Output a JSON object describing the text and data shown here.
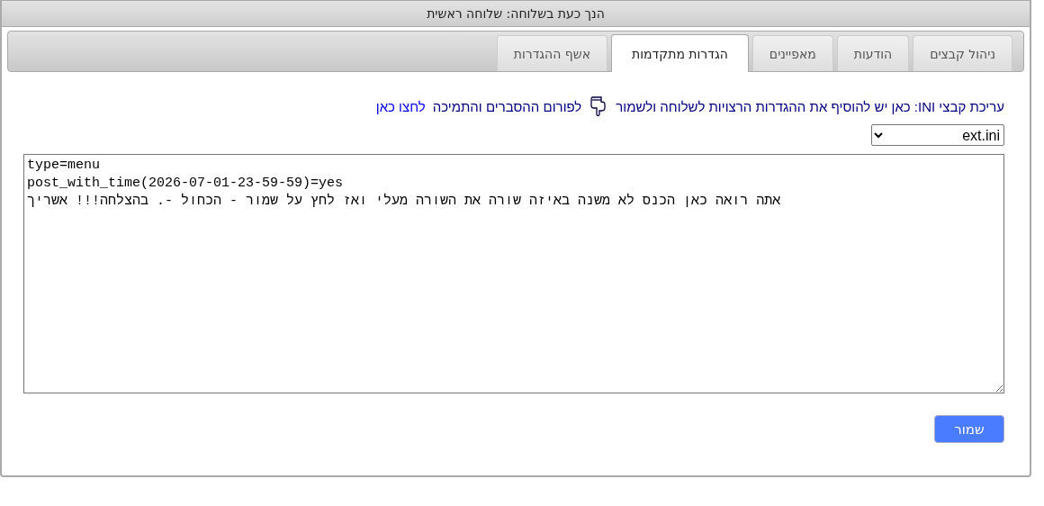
{
  "window": {
    "title": "הנך כעת בשלוחה: שלוחה ראשית"
  },
  "tabs": [
    {
      "label": "ניהול קבצים",
      "selected": false
    },
    {
      "label": "הודעות",
      "selected": false
    },
    {
      "label": "מאפיינים",
      "selected": false
    },
    {
      "label": "הגדרות מתקדמות",
      "selected": true
    },
    {
      "label": "אשף ההגדרות",
      "selected": false
    }
  ],
  "notice": {
    "text": "עריכת קבצי INI: כאן יש להוסיף את ההגדרות הרצויות לשלוחה ולשמור",
    "forum_text": "לפורום ההסברים והתמיכה",
    "link": "לחצו כאן"
  },
  "file_select": {
    "value": "ext.ini"
  },
  "editor": {
    "lines": [
      "type=menu",
      "post_with_time(2026-07-01-23-59-59)=yes",
      "אתה רואה כאן הכנס לא משנה באיזה שורה את השורה מעלי ואז לחץ על שמור - הכחול -. בהצלחה!!! אשריך"
    ]
  },
  "save_button": "שמור"
}
